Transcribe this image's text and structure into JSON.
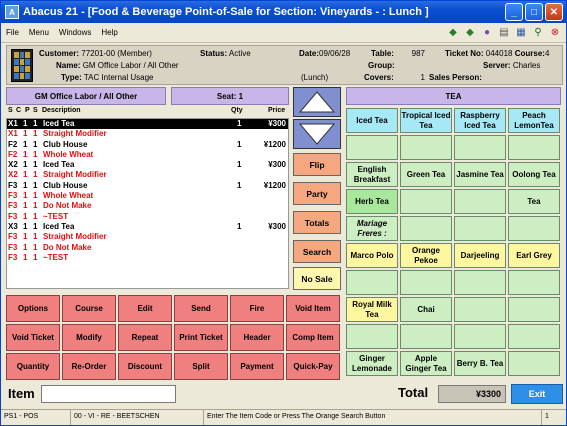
{
  "window": {
    "title": "Abacus 21 - [Food & Beverage Point-of-Sale for Section: Vineyards - : Lunch ]",
    "app_icon": "A"
  },
  "menu": [
    "File",
    "Menu",
    "Windows",
    "Help"
  ],
  "toolbar_icons": [
    "arrow-left-icon",
    "arrow-right-icon",
    "group-icon",
    "document-icon",
    "calculator-icon",
    "running-man-icon",
    "stop-icon"
  ],
  "info": {
    "customer_label": "Customer:",
    "customer": "77201-00 (Member)",
    "name_label": "Name:",
    "name": "GM Office Labor / All Other",
    "type_label": "Type:",
    "type": "TAC Internal Usage",
    "status_label": "Status:",
    "status": "Active",
    "date_label": "Date:",
    "date": "09/06/28",
    "period": "(Lunch)",
    "table_label": "Table:",
    "table": "987",
    "group_label": "Group:",
    "group": "",
    "covers_label": "Covers:",
    "covers": "1",
    "ticket_label": "Ticket No:",
    "ticket": "044018",
    "course_label": "Course:",
    "course": "4",
    "server_label": "Server:",
    "server": "Charles",
    "sales_label": "Sales Person:",
    "sales": ""
  },
  "order": {
    "account_bar": "GM Office Labor / All Other",
    "seat_bar": "Seat: 1",
    "columns": {
      "s": "S",
      "c": "C",
      "p": "P",
      "s2": "S",
      "desc": "Description",
      "qty": "Qty",
      "price": "Price"
    },
    "lines": [
      {
        "code": "X1",
        "s": "1",
        "p": "1",
        "desc": "Iced Tea",
        "qty": "1",
        "price": "¥300",
        "style": "sel"
      },
      {
        "code": "X1",
        "s": "1",
        "p": "1",
        "desc": "   Straight Modifier",
        "qty": "",
        "price": "",
        "style": "red"
      },
      {
        "code": "F2",
        "s": "1",
        "p": "1",
        "desc": "Club House",
        "qty": "1",
        "price": "¥1200",
        "style": ""
      },
      {
        "code": "F2",
        "s": "1",
        "p": "1",
        "desc": "   Whole Wheat",
        "qty": "",
        "price": "",
        "style": "red"
      },
      {
        "code": "X2",
        "s": "1",
        "p": "1",
        "desc": "Iced Tea",
        "qty": "1",
        "price": "¥300",
        "style": ""
      },
      {
        "code": "X2",
        "s": "1",
        "p": "1",
        "desc": "   Straight Modifier",
        "qty": "",
        "price": "",
        "style": "red"
      },
      {
        "code": "F3",
        "s": "1",
        "p": "1",
        "desc": "Club House",
        "qty": "1",
        "price": "¥1200",
        "style": ""
      },
      {
        "code": "F3",
        "s": "1",
        "p": "1",
        "desc": "   Whole Wheat",
        "qty": "",
        "price": "",
        "style": "red"
      },
      {
        "code": "F3",
        "s": "1",
        "p": "1",
        "desc": "   Do Not Make",
        "qty": "",
        "price": "",
        "style": "red"
      },
      {
        "code": "F3",
        "s": "1",
        "p": "1",
        "desc": "   ~TEST",
        "qty": "",
        "price": "",
        "style": "red"
      },
      {
        "code": "X3",
        "s": "1",
        "p": "1",
        "desc": "Iced Tea",
        "qty": "1",
        "price": "¥300",
        "style": ""
      },
      {
        "code": "F3",
        "s": "1",
        "p": "1",
        "desc": "   Straight Modifier",
        "qty": "",
        "price": "",
        "style": "red"
      },
      {
        "code": "F3",
        "s": "1",
        "p": "1",
        "desc": "   Do Not Make",
        "qty": "",
        "price": "",
        "style": "red"
      },
      {
        "code": "F3",
        "s": "1",
        "p": "1",
        "desc": "   ~TEST",
        "qty": "",
        "price": "",
        "style": "red"
      }
    ]
  },
  "side_buttons": [
    "Flip",
    "Party",
    "Totals",
    "Search",
    "No Sale"
  ],
  "category": "TEA",
  "items": [
    {
      "label": "Iced Tea",
      "color": "cyan"
    },
    {
      "label": "Tropical Iced Tea",
      "color": "cyan"
    },
    {
      "label": "Raspberry Iced Tea",
      "color": "cyan"
    },
    {
      "label": "Peach LemonTea",
      "color": "cyan"
    },
    {
      "label": "",
      "color": ""
    },
    {
      "label": "",
      "color": ""
    },
    {
      "label": "",
      "color": ""
    },
    {
      "label": "",
      "color": ""
    },
    {
      "label": "English Breakfast",
      "color": ""
    },
    {
      "label": "Green Tea",
      "color": ""
    },
    {
      "label": "Jasmine Tea",
      "color": ""
    },
    {
      "label": "Oolong Tea",
      "color": ""
    },
    {
      "label": "Herb Tea",
      "color": "green"
    },
    {
      "label": "",
      "color": ""
    },
    {
      "label": "",
      "color": ""
    },
    {
      "label": "Tea",
      "color": ""
    },
    {
      "label": "Mariage Freres :",
      "color": "",
      "italic": true
    },
    {
      "label": "",
      "color": ""
    },
    {
      "label": "",
      "color": ""
    },
    {
      "label": "",
      "color": ""
    },
    {
      "label": "Marco Polo",
      "color": "yellow"
    },
    {
      "label": "Orange Pekoe",
      "color": "yellow"
    },
    {
      "label": "Darjeeling",
      "color": "yellow"
    },
    {
      "label": "Earl Grey",
      "color": "yellow"
    },
    {
      "label": "",
      "color": ""
    },
    {
      "label": "",
      "color": ""
    },
    {
      "label": "",
      "color": ""
    },
    {
      "label": "",
      "color": ""
    },
    {
      "label": "Royal Milk Tea",
      "color": "yellow"
    },
    {
      "label": "Chai",
      "color": ""
    },
    {
      "label": "",
      "color": ""
    },
    {
      "label": "",
      "color": ""
    },
    {
      "label": "",
      "color": ""
    },
    {
      "label": "",
      "color": ""
    },
    {
      "label": "",
      "color": ""
    },
    {
      "label": "",
      "color": ""
    },
    {
      "label": "Ginger Lemonade",
      "color": ""
    },
    {
      "label": "Apple Ginger Tea",
      "color": ""
    },
    {
      "label": "Berry B. Tea",
      "color": ""
    },
    {
      "label": "",
      "color": ""
    }
  ],
  "commands": [
    "Options",
    "Course",
    "Edit",
    "Send",
    "Fire",
    "Void Item",
    "Void Ticket",
    "Modify",
    "Repeat",
    "Print Ticket",
    "Header",
    "Comp Item",
    "Quantity",
    "Re-Order",
    "Discount",
    "Split",
    "Payment",
    "Quick-Pay"
  ],
  "footer": {
    "item_label": "Item",
    "item_value": "",
    "total_label": "Total",
    "total_value": "¥3300",
    "exit_label": "Exit"
  },
  "status": {
    "terminal": "PS1 - POS",
    "user": "00 - VI - RE - BEETSCHEN",
    "message": "Enter The Item Code or Press The Orange Search Button",
    "page": "1"
  }
}
